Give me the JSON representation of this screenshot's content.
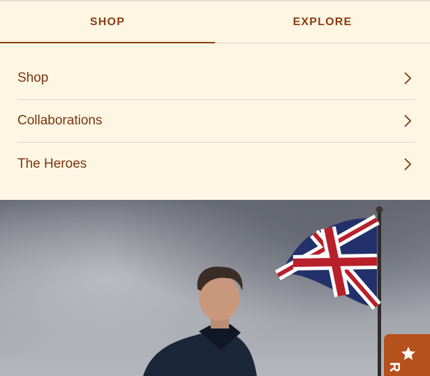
{
  "tabs": [
    {
      "label": "SHOP",
      "active": true
    },
    {
      "label": "EXPLORE",
      "active": false
    }
  ],
  "menu": {
    "items": [
      {
        "label": "Shop"
      },
      {
        "label": "Collaborations"
      },
      {
        "label": "The Heroes"
      }
    ]
  },
  "hero": {
    "image": "man-in-navy-coat-with-union-jack-flag"
  },
  "review_tab": {
    "icon": "star-icon",
    "label": "R"
  },
  "colors": {
    "background": "#fdf6e3",
    "accent": "#8b3d12",
    "review_tab": "#b5511c"
  }
}
